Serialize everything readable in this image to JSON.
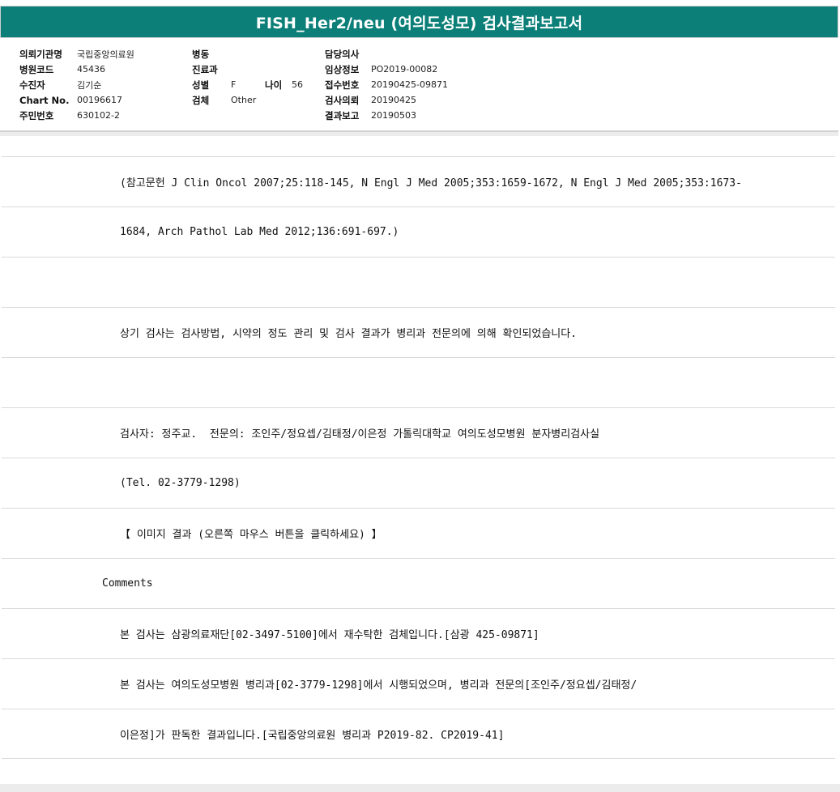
{
  "title": "FISH_Her2/neu (여의도성모) 검사결과보고서",
  "header": {
    "col1": [
      {
        "label": "의뢰기관명",
        "value": "국립중앙의료원"
      },
      {
        "label": "병원코드",
        "value": "45436"
      },
      {
        "label": "수진자",
        "value": "김기순"
      },
      {
        "label": "Chart No.",
        "value": "00196617"
      },
      {
        "label": "주민번호",
        "value": "630102-2"
      }
    ],
    "col2": {
      "ward_label": "병동",
      "dept_label": "진료과",
      "sex_label": "성별",
      "sex_value": "F",
      "age_label": "나이",
      "age_value": "56",
      "specimen_label": "검체",
      "specimen_value": "Other"
    },
    "col3": [
      {
        "label": "담당의사",
        "value": ""
      },
      {
        "label": "임상정보",
        "value": "PO2019-00082"
      },
      {
        "label": "접수번호",
        "value": "20190425-09871"
      },
      {
        "label": "검사의뢰",
        "value": "20190425"
      },
      {
        "label": "결과보고",
        "value": "20190503"
      }
    ]
  },
  "report_lines": [
    "(참고문헌 J Clin Oncol 2007;25:118-145, N Engl J Med 2005;353:1659-1672, N Engl J Med 2005;353:1673-",
    "1684, Arch Pathol Lab Med 2012;136:691-697.)",
    "",
    "상기 검사는 검사방법, 시약의 정도 관리 및 검사 결과가 병리과 전문의에 의해 확인되었습니다.",
    "",
    "검사자: 정주교.  전문의: 조인주/정요셉/김태정/이은정 가톨릭대학교 여의도성모병원 분자병리검사실",
    "(Tel. 02-3779-1298)",
    "【 이미지 결과 (오른쪽 마우스 버튼을 클릭하세요) 】",
    "Comments",
    "본 검사는 삼광의료재단[02-3497-5100]에서 재수탁한 검체입니다.[삼광 425-09871]",
    "본 검사는 여의도성모병원 병리과[02-3779-1298]에서 시행되었으며, 병리과 전문의[조인주/정요셉/김태정/",
    "이은정]가 판독한 결과입니다.[국립중앙의료원 병리과 P2019-82. CP2019-41]"
  ],
  "colors": {
    "title_bg": "#0b7f78",
    "title_fg": "#ffffff",
    "divider": "#d9d9d9"
  }
}
